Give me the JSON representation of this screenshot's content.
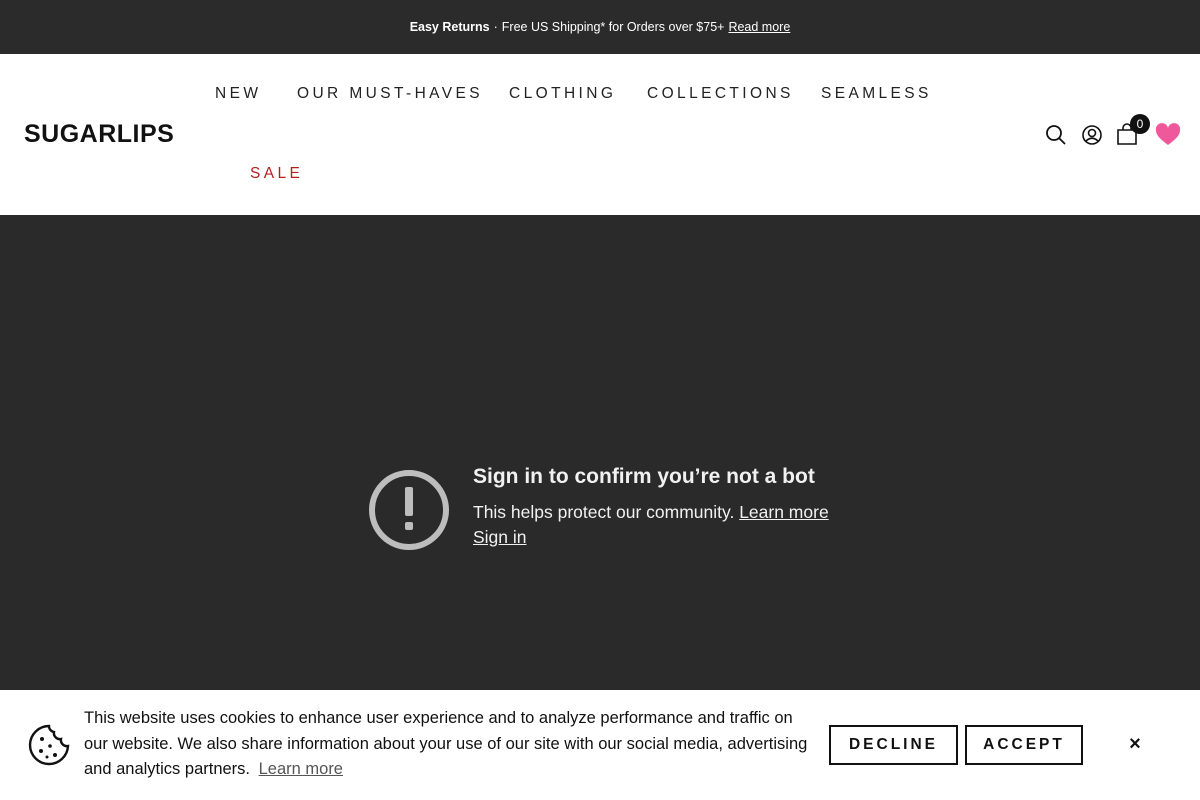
{
  "announcement": {
    "bold_text": "Easy Returns",
    "separator": "·",
    "text": "Free US Shipping* for Orders over $75+",
    "link": "Read more"
  },
  "header": {
    "logo": "SUGARLIPS",
    "nav": [
      "NEW",
      "OUR MUST-HAVES",
      "CLOTHING",
      "COLLECTIONS",
      "SEAMLESS",
      "SALE"
    ],
    "cart_count": "0",
    "icons": [
      "search-icon",
      "account-icon",
      "cart-icon",
      "wishlist-heart-icon"
    ],
    "colors": {
      "sale": "#b51f1f",
      "heart": "#f0589c"
    }
  },
  "main": {
    "title": "Sign in to confirm you’re not a bot",
    "body": "This helps protect our community.",
    "learn_more": "Learn more",
    "sign_in": "Sign in",
    "background": "#2a2a2a"
  },
  "cookie": {
    "text": "This website uses cookies to enhance user experience and to analyze performance and traffic on our website. We also share information about your use of our site with our social media, advertising and analytics partners.",
    "learn_more": "Learn more",
    "decline": "DECLINE",
    "accept": "ACCEPT",
    "close": "×"
  }
}
